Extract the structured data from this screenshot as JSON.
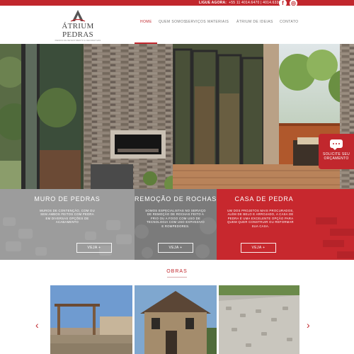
{
  "topbar": {
    "call_label": "LIGUE AGORA:",
    "phones": "+55 11 4014.6470 | 4014.6336",
    "facebook_glyph": "f",
    "instagram_glyph": "◎"
  },
  "logo": {
    "name": "ÁTRIUM PEDRAS",
    "tagline": "PEDRAS DE REVESTIMENTO E DECORATIVAS"
  },
  "nav": {
    "items": [
      "HOME",
      "QUEM SOMOS",
      "SERVIÇOS",
      "MATERIAIS",
      "ÁTRIUM DE IDEIAS",
      "CONTATO"
    ],
    "active": "HOME"
  },
  "quote_button": {
    "line1": "SOLICITE SEU",
    "line2": "ORÇAMENTO"
  },
  "services": [
    {
      "title": "MURO DE PEDRAS",
      "desc": [
        "MUROS DE CONTENÇÃO, COM OU",
        "SEM AMBOS FEITOS COM PEDRA",
        "EM DIVERSAS OPÇÕES DE",
        "ACABAMENTO"
      ],
      "button": "VEJA +"
    },
    {
      "title": "REMOÇÃO DE ROCHAS",
      "desc": [
        "SOMOS ESPECIALISTAS NO SERVIÇO",
        "DE REMOÇÃO DE ROCHAS FEITO A",
        "FRIO OU A FOGO COM USO DE",
        "TECNOLOGIA COM USO EXPANSIVO",
        "E ROMPEDORES."
      ],
      "button": "VEJA +"
    },
    {
      "title": "CASA DE PEDRA",
      "desc": [
        "UM DOS PROJETOS MAIS PROCURADOS,",
        "ALÉM DE BELO E ARROJADO, A CASA DE",
        "PEDRA É UMA EXCELENTE OPÇÃO PARA",
        "QUEM QUER CONSTRUIR OU REFORMAR",
        "SUA CASA."
      ],
      "button": "VEJA +"
    }
  ],
  "obras": {
    "title": "OBRAS",
    "prev_glyph": "‹",
    "next_glyph": "›"
  },
  "colors": {
    "brand_red": "#c1272d",
    "gray_light": "#9c9c9c",
    "gray_dark": "#7b7b7b"
  }
}
